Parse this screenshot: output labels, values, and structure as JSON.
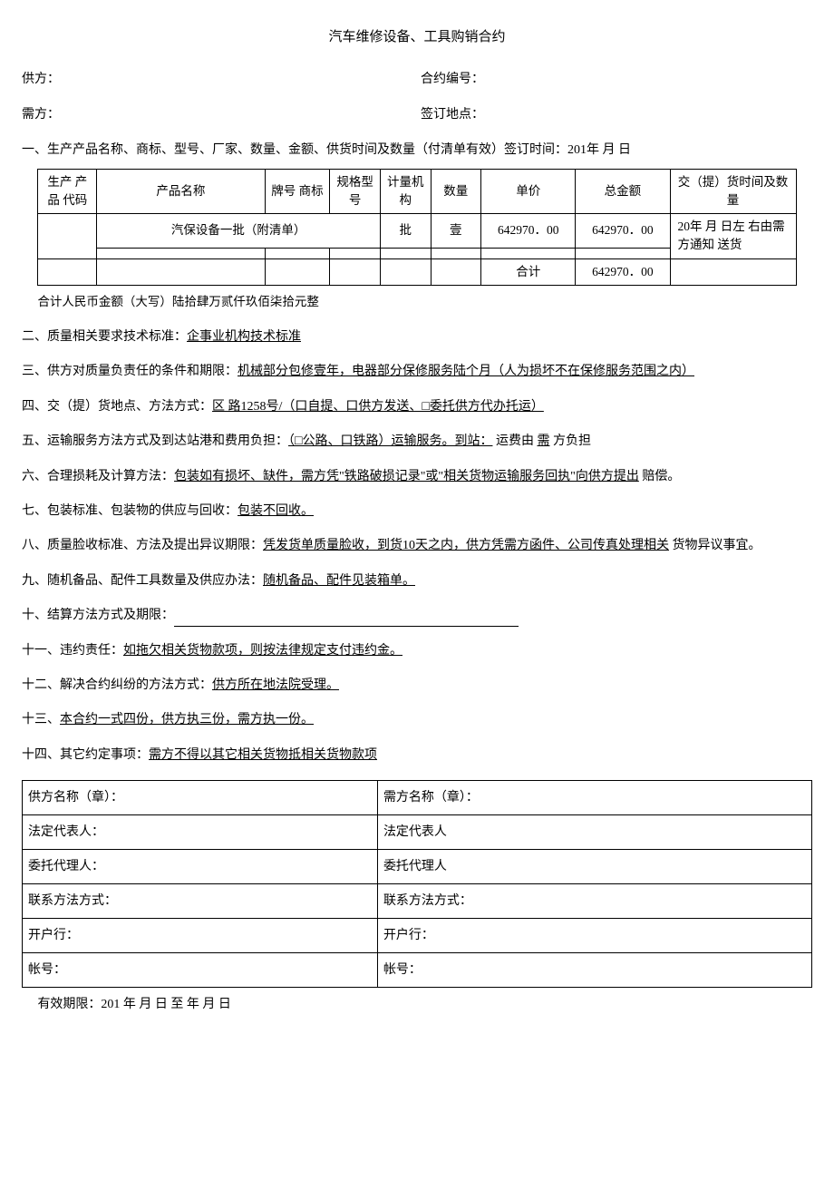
{
  "title": "汽车维修设备、工具购销合约",
  "header": {
    "supplier_label": "供方：",
    "contract_no_label": "合约编号：",
    "buyer_label": "需方：",
    "sign_place_label": "签订地点："
  },
  "section1": {
    "text": "一、生产产品名称、商标、型号、厂家、数量、金额、供货时间及数量（付清单有效）签订时间：201年 月 日"
  },
  "table": {
    "h_code": "生产 产品 代码",
    "h_name": "产品名称",
    "h_brand": "牌号 商标",
    "h_spec": "规格型号",
    "h_unit": "计量机构",
    "h_qty": "数量",
    "h_price": "单价",
    "h_total": "总金额",
    "h_delivery": "交（提）货时间及数量",
    "r1_name": "汽保设备一批（附清单）",
    "r1_unit": "批",
    "r1_qty": "壹",
    "r1_price": "642970．00",
    "r1_total": "642970．00",
    "r1_delivery": "20年 月 日左 右由需方通知 送货",
    "sum_label": "合计",
    "sum_total": "642970．00"
  },
  "amount_cn": "合计人民币金额（大写）陆拾肆万贰仟玖佰柒拾元整",
  "clauses": {
    "c2_lbl": "二、质量相关要求技术标准：",
    "c2_u": "企事业机构技术标准",
    "c3_lbl": "三、供方对质量负责任的条件和期限：",
    "c3_u": "机械部分包修壹年，电器部分保修服务陆个月（人为损坏不在保修服务范围之内）",
    "c4_lbl": "四、交（提）货地点、方法方式：",
    "c4_u": "区 路1258号/（口自提、口供方发送、□委托供方代办托运）",
    "c5_lbl": "五、运输服务方法方式及到达站港和费用负担：",
    "c5_u": "（□公路、口铁路）运输服务。到站：",
    "c5_tail1": " 运费由 ",
    "c5_u2": "需",
    "c5_tail2": " 方负担",
    "c6_lbl": "六、合理损耗及计算方法：",
    "c6_u": "包装如有损坏、缺件，需方凭\"铁路破损记录\"或\"相关货物运输服务回执\"向供方提出",
    "c6_tail": " 赔偿。",
    "c7_lbl": "七、包装标准、包装物的供应与回收：",
    "c7_u": "包装不回收。",
    "c8_lbl": "八、质量脸收标准、方法及提出异议期限：",
    "c8_u": "凭发货单质量脸收，到货10天之内，供方凭需方函件、公司传真处理相关",
    "c8_tail": " 货物异议事宜。",
    "c9_lbl": "九、随机备品、配件工具数量及供应办法：",
    "c9_u": "随机备品、配件见装箱单。",
    "c10_lbl": "十、结算方法方式及期限：",
    "c11_lbl": "十一、违约责任：",
    "c11_u": "如拖欠相关货物款项，则按法律规定支付违约金。",
    "c12_lbl": "十二、解决合约纠纷的方法方式：",
    "c12_u": "供方所在地法院受理。",
    "c13_lbl": "十三、",
    "c13_u": "本合约一式四份，供方执三份，需方执一份。",
    "c14_lbl": "十四、其它约定事项：",
    "c14_u": "需方不得以其它相关货物抵相关货物款项"
  },
  "sig": {
    "sup_name": "供方名称（章）：",
    "buy_name": "需方名称（章）：",
    "sup_legal": "法定代表人：",
    "buy_legal": "法定代表人",
    "sup_agent": "委托代理人：",
    "buy_agent": "委托代理人",
    "sup_contact": "联系方法方式：",
    "buy_contact": "联系方法方式：",
    "sup_bank": "开户行：",
    "buy_bank": "开户行：",
    "sup_acct": "帐号：",
    "buy_acct": "帐号："
  },
  "validity": "有效期限：201 年 月 日 至 年 月 日"
}
